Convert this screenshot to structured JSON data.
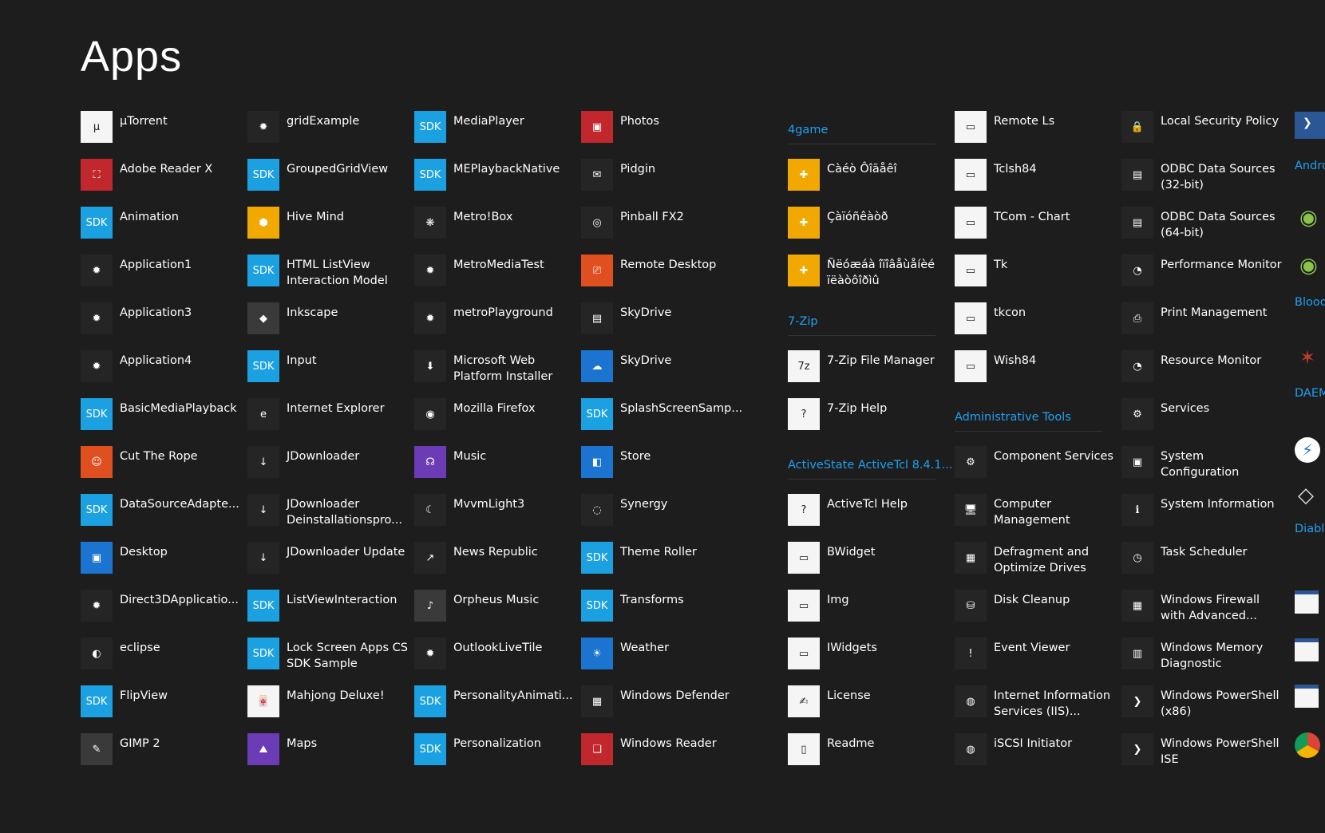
{
  "page_title": "Apps",
  "columns": [
    [
      {
        "label": "µTorrent",
        "icon": "utorrent-icon",
        "glyph": "µ",
        "style": "ic-white"
      },
      {
        "label": "Adobe Reader X",
        "icon": "adobe-reader-icon",
        "glyph": "⛶",
        "style": "ic-red"
      },
      {
        "label": "Animation",
        "icon": "sdk-icon",
        "glyph": "SDK",
        "style": "sdk"
      },
      {
        "label": "Application1",
        "icon": "sun-placeholder-icon",
        "glyph": "✹",
        "style": "ic-dark"
      },
      {
        "label": "Application3",
        "icon": "sun-placeholder-icon",
        "glyph": "✹",
        "style": "ic-dark"
      },
      {
        "label": "Application4",
        "icon": "sun-placeholder-icon",
        "glyph": "✹",
        "style": "ic-dark"
      },
      {
        "label": "BasicMediaPlayback",
        "icon": "sdk-icon",
        "glyph": "SDK",
        "style": "sdk"
      },
      {
        "label": "Cut The Rope",
        "icon": "cut-the-rope-icon",
        "glyph": "☺",
        "style": "ic-orange"
      },
      {
        "label": "DataSourceAdapte...",
        "icon": "sdk-icon",
        "glyph": "SDK",
        "style": "sdk"
      },
      {
        "label": "Desktop",
        "icon": "desktop-icon",
        "glyph": "▣",
        "style": "ic-blue"
      },
      {
        "label": "Direct3DApplicatio...",
        "icon": "sun-placeholder-icon",
        "glyph": "✹",
        "style": "ic-dark"
      },
      {
        "label": "eclipse",
        "icon": "eclipse-icon",
        "glyph": "◐",
        "style": "ic-dark"
      },
      {
        "label": "FlipView",
        "icon": "sdk-icon",
        "glyph": "SDK",
        "style": "sdk"
      },
      {
        "label": "GIMP 2",
        "icon": "gimp-icon",
        "glyph": "✎",
        "style": "ic-gray"
      }
    ],
    [
      {
        "label": "gridExample",
        "icon": "sun-placeholder-icon",
        "glyph": "✹",
        "style": "ic-dark"
      },
      {
        "label": "GroupedGridView",
        "icon": "sdk-icon",
        "glyph": "SDK",
        "style": "sdk"
      },
      {
        "label": "Hive Mind",
        "icon": "hive-mind-icon",
        "glyph": "⬢",
        "style": "ic-yellow"
      },
      {
        "label": "HTML ListView Interaction Model",
        "icon": "sdk-icon",
        "glyph": "SDK",
        "style": "sdk"
      },
      {
        "label": "Inkscape",
        "icon": "inkscape-icon",
        "glyph": "◆",
        "style": "ic-gray"
      },
      {
        "label": "Input",
        "icon": "sdk-icon",
        "glyph": "SDK",
        "style": "sdk"
      },
      {
        "label": "Internet Explorer",
        "icon": "internet-explorer-icon",
        "glyph": "e",
        "style": "ic-dark"
      },
      {
        "label": "JDownloader",
        "icon": "jdownloader-icon",
        "glyph": "↓",
        "style": "ic-dark"
      },
      {
        "label": "JDownloader Deinstallationspro...",
        "icon": "jdownloader-icon",
        "glyph": "↓",
        "style": "ic-dark"
      },
      {
        "label": "JDownloader Update",
        "icon": "jdownloader-icon",
        "glyph": "↓",
        "style": "ic-dark"
      },
      {
        "label": "ListViewInteraction",
        "icon": "sdk-icon",
        "glyph": "SDK",
        "style": "sdk"
      },
      {
        "label": "Lock Screen Apps CS SDK Sample",
        "icon": "sdk-icon",
        "glyph": "SDK",
        "style": "sdk"
      },
      {
        "label": "Mahjong Deluxe!",
        "icon": "mahjong-icon",
        "glyph": "🀄",
        "style": "ic-white"
      },
      {
        "label": "Maps",
        "icon": "maps-icon",
        "glyph": "⛰",
        "style": "ic-purple"
      }
    ],
    [
      {
        "label": "MediaPlayer",
        "icon": "sdk-icon",
        "glyph": "SDK",
        "style": "sdk"
      },
      {
        "label": "MEPlaybackNative",
        "icon": "sdk-icon",
        "glyph": "SDK",
        "style": "sdk"
      },
      {
        "label": "Metro!Box",
        "icon": "metrobox-icon",
        "glyph": "❋",
        "style": "ic-dark"
      },
      {
        "label": "MetroMediaTest",
        "icon": "sun-placeholder-icon",
        "glyph": "✹",
        "style": "ic-dark"
      },
      {
        "label": "metroPlayground",
        "icon": "sun-placeholder-icon",
        "glyph": "✹",
        "style": "ic-dark"
      },
      {
        "label": "Microsoft Web Platform Installer",
        "icon": "web-platform-installer-icon",
        "glyph": "⬇",
        "style": "ic-dark"
      },
      {
        "label": "Mozilla Firefox",
        "icon": "firefox-icon",
        "glyph": "◉",
        "style": "ic-dark"
      },
      {
        "label": "Music",
        "icon": "headphones-icon",
        "glyph": "☊",
        "style": "ic-purple"
      },
      {
        "label": "MvvmLight3",
        "icon": "mvvmlight-icon",
        "glyph": "☾",
        "style": "ic-dark"
      },
      {
        "label": "News Republic",
        "icon": "news-republic-icon",
        "glyph": "↗",
        "style": "ic-dark"
      },
      {
        "label": "Orpheus Music",
        "icon": "orpheus-music-icon",
        "glyph": "♪",
        "style": "ic-gray"
      },
      {
        "label": "OutlookLiveTile",
        "icon": "sun-placeholder-icon",
        "glyph": "✹",
        "style": "ic-dark"
      },
      {
        "label": "PersonalityAnimati...",
        "icon": "sdk-icon",
        "glyph": "SDK",
        "style": "sdk"
      },
      {
        "label": "Personalization",
        "icon": "sdk-icon",
        "glyph": "SDK",
        "style": "sdk"
      }
    ],
    [
      {
        "label": "Photos",
        "icon": "photos-icon",
        "glyph": "▣",
        "style": "ic-red"
      },
      {
        "label": "Pidgin",
        "icon": "pidgin-icon",
        "glyph": "✉",
        "style": "ic-dark"
      },
      {
        "label": "Pinball FX2",
        "icon": "pinball-icon",
        "glyph": "◎",
        "style": "ic-dark"
      },
      {
        "label": "Remote Desktop",
        "icon": "remote-desktop-icon",
        "glyph": "⎚",
        "style": "ic-orange"
      },
      {
        "label": "SkyDrive",
        "icon": "folder-icon",
        "glyph": "▤",
        "style": "ic-dark"
      },
      {
        "label": "SkyDrive",
        "icon": "cloud-icon",
        "glyph": "☁",
        "style": "ic-blue"
      },
      {
        "label": "SplashScreenSamp...",
        "icon": "sdk-icon",
        "glyph": "SDK",
        "style": "sdk"
      },
      {
        "label": "Store",
        "icon": "store-bag-icon",
        "glyph": "◧",
        "style": "ic-blue"
      },
      {
        "label": "Synergy",
        "icon": "synergy-icon",
        "glyph": "◌",
        "style": "ic-dark"
      },
      {
        "label": "Theme Roller",
        "icon": "sdk-icon",
        "glyph": "SDK",
        "style": "sdk"
      },
      {
        "label": "Transforms",
        "icon": "sdk-icon",
        "glyph": "SDK",
        "style": "sdk"
      },
      {
        "label": "Weather",
        "icon": "weather-sun-icon",
        "glyph": "☀",
        "style": "ic-blue"
      },
      {
        "label": "Windows Defender",
        "icon": "windows-defender-icon",
        "glyph": "▦",
        "style": "ic-dark"
      },
      {
        "label": "Windows Reader",
        "icon": "windows-reader-icon",
        "glyph": "❏",
        "style": "ic-red"
      }
    ],
    [
      {
        "group": "4game"
      },
      {
        "label": "Càéò Ôîãåêî",
        "icon": "4game-icon",
        "glyph": "✚",
        "style": "ic-yellow"
      },
      {
        "label": "Çàïóñêàòð",
        "icon": "4game-icon",
        "glyph": "✚",
        "style": "ic-yellow"
      },
      {
        "label": "Ñëóæáà îïîâåùåíèé ïëàòôîðìû",
        "icon": "4game-icon",
        "glyph": "✚",
        "style": "ic-yellow"
      },
      {
        "group": "7-Zip"
      },
      {
        "label": "7-Zip File Manager",
        "icon": "7zip-icon",
        "glyph": "7z",
        "style": "ic-white"
      },
      {
        "label": "7-Zip Help",
        "icon": "help-file-icon",
        "glyph": "?",
        "style": "ic-white"
      },
      {
        "group": "ActiveState ActiveTcl 8.4.1..."
      },
      {
        "label": "ActiveTcl Help",
        "icon": "help-file-icon",
        "glyph": "?",
        "style": "ic-white"
      },
      {
        "label": "BWidget",
        "icon": "window-app-icon",
        "glyph": "▭",
        "style": "ic-white"
      },
      {
        "label": "Img",
        "icon": "window-app-icon",
        "glyph": "▭",
        "style": "ic-white"
      },
      {
        "label": "IWidgets",
        "icon": "window-app-icon",
        "glyph": "▭",
        "style": "ic-white"
      },
      {
        "label": "License",
        "icon": "license-icon",
        "glyph": "✍",
        "style": "ic-white"
      },
      {
        "label": "Readme",
        "icon": "document-icon",
        "glyph": "▯",
        "style": "ic-white"
      }
    ],
    [
      {
        "label": "Remote Ls",
        "icon": "window-app-icon",
        "glyph": "▭",
        "style": "ic-white"
      },
      {
        "label": "Tclsh84",
        "icon": "window-app-icon",
        "glyph": "▭",
        "style": "ic-white"
      },
      {
        "label": "TCom - Chart",
        "icon": "window-app-icon",
        "glyph": "▭",
        "style": "ic-white"
      },
      {
        "label": "Tk",
        "icon": "window-app-icon",
        "glyph": "▭",
        "style": "ic-white"
      },
      {
        "label": "tkcon",
        "icon": "window-app-icon",
        "glyph": "▭",
        "style": "ic-white"
      },
      {
        "label": "Wish84",
        "icon": "window-app-icon",
        "glyph": "▭",
        "style": "ic-white"
      },
      {
        "group": "Administrative Tools"
      },
      {
        "label": "Component Services",
        "icon": "component-services-icon",
        "glyph": "⚙",
        "style": "ic-dark"
      },
      {
        "label": "Computer Management",
        "icon": "computer-management-icon",
        "glyph": "🖥",
        "style": "ic-dark"
      },
      {
        "label": "Defragment and Optimize Drives",
        "icon": "defragment-icon",
        "glyph": "▦",
        "style": "ic-dark"
      },
      {
        "label": "Disk Cleanup",
        "icon": "disk-cleanup-icon",
        "glyph": "⛁",
        "style": "ic-dark"
      },
      {
        "label": "Event Viewer",
        "icon": "event-viewer-icon",
        "glyph": "!",
        "style": "ic-dark"
      },
      {
        "label": "Internet Information Services (IIS)...",
        "icon": "iis-icon",
        "glyph": "◍",
        "style": "ic-dark"
      },
      {
        "label": "iSCSI Initiator",
        "icon": "iscsi-icon",
        "glyph": "◍",
        "style": "ic-dark"
      }
    ],
    [
      {
        "label": "Local Security Policy",
        "icon": "security-policy-icon",
        "glyph": "🔒",
        "style": "ic-dark"
      },
      {
        "label": "ODBC Data Sources (32-bit)",
        "icon": "odbc-icon",
        "glyph": "▤",
        "style": "ic-dark"
      },
      {
        "label": "ODBC Data Sources (64-bit)",
        "icon": "odbc-icon",
        "glyph": "▤",
        "style": "ic-dark"
      },
      {
        "label": "Performance Monitor",
        "icon": "performance-monitor-icon",
        "glyph": "◔",
        "style": "ic-dark"
      },
      {
        "label": "Print Management",
        "icon": "print-management-icon",
        "glyph": "⎙",
        "style": "ic-dark"
      },
      {
        "label": "Resource Monitor",
        "icon": "resource-monitor-icon",
        "glyph": "◔",
        "style": "ic-dark"
      },
      {
        "label": "Services",
        "icon": "services-gear-icon",
        "glyph": "⚙",
        "style": "ic-dark"
      },
      {
        "label": "System Configuration",
        "icon": "system-configuration-icon",
        "glyph": "▣",
        "style": "ic-dark"
      },
      {
        "label": "System Information",
        "icon": "system-information-icon",
        "glyph": "ℹ",
        "style": "ic-dark"
      },
      {
        "label": "Task Scheduler",
        "icon": "clock-icon",
        "glyph": "◷",
        "style": "ic-dark"
      },
      {
        "label": "Windows Firewall with Advanced...",
        "icon": "firewall-icon",
        "glyph": "▦",
        "style": "ic-dark"
      },
      {
        "label": "Windows Memory Diagnostic",
        "icon": "memory-diagnostic-icon",
        "glyph": "▥",
        "style": "ic-dark"
      },
      {
        "label": "Windows PowerShell (x86)",
        "icon": "powershell-icon",
        "glyph": "❯",
        "style": "ic-dark"
      },
      {
        "label": "Windows PowerShell ISE",
        "icon": "powershell-ise-icon",
        "glyph": "❯",
        "style": "ic-dark"
      }
    ]
  ],
  "edge_column": {
    "groups": [
      "Andro",
      "Blood",
      "DAEM",
      "Diablo"
    ],
    "icons": [
      "powershell-icon",
      "android-icon",
      "android-icon",
      "bug-icon",
      "lightning-icon",
      "diamond-icon",
      "window-app-icon",
      "window-app-icon",
      "window-app-icon",
      "chrome-icon"
    ]
  },
  "colors": {
    "background": "#1d1d1d",
    "accent": "#1ea1f2",
    "sdk": "#1ba1e2"
  }
}
